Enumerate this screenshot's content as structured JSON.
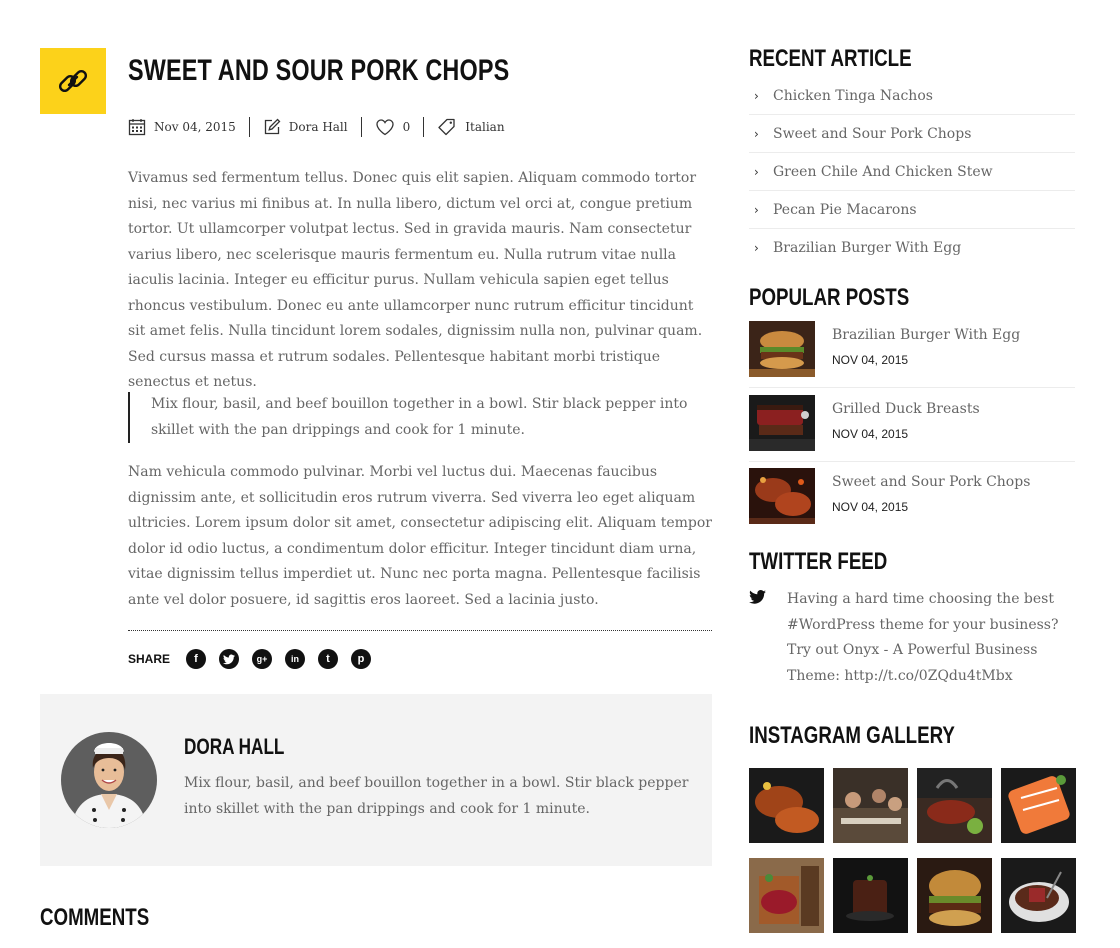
{
  "post": {
    "title": "SWEET AND SOUR PORK CHOPS",
    "icon": "link-icon",
    "accent": "#fcd21a",
    "date": "Nov 04, 2015",
    "author": "Dora Hall",
    "likes": "0",
    "category": "Italian",
    "paragraph1": "Vivamus sed fermentum tellus. Donec quis elit sapien. Aliquam commodo tortor nisi, nec varius mi finibus at. In nulla libero, dictum vel orci at, congue pretium tortor. Ut ullamcorper volutpat lectus. Sed in gravida mauris. Nam consectetur varius libero, nec scelerisque mauris fermentum eu. Nulla rutrum vitae nulla iaculis lacinia. Integer eu efficitur purus. Nullam vehicula sapien eget tellus rhoncus vestibulum. Donec eu ante ullamcorper nunc rutrum efficitur tincidunt sit amet felis. Nulla tincidunt lorem sodales, dignissim nulla non, pulvinar quam. Sed cursus massa et rutrum sodales. Pellentesque habitant morbi tristique senectus et netus.",
    "quote": "Mix flour, basil, and beef bouillon together in a bowl. Stir black pepper into skillet with the pan drippings and cook for 1 minute.",
    "paragraph2": "Nam vehicula commodo pulvinar. Morbi vel luctus dui. Maecenas faucibus dignissim ante, et sollicitudin eros rutrum viverra. Sed viverra leo eget aliquam ultricies. Lorem ipsum dolor sit amet, consectetur adipiscing elit. Aliquam tempor dolor id odio luctus, a condimentum dolor efficitur. Integer tincidunt diam urna, vitae dignissim tellus imperdiet ut. Nunc nec porta magna. Pellentesque facilisis ante vel dolor posuere, id sagittis eros laoreet. Sed a lacinia justo."
  },
  "share": {
    "label": "SHARE",
    "icons": [
      "facebook-icon",
      "twitter-icon",
      "google-plus-icon",
      "linkedin-icon",
      "tumblr-icon",
      "pinterest-icon"
    ]
  },
  "author_box": {
    "name": "DORA HALL",
    "bio": "Mix flour, basil, and beef bouillon together in a bowl. Stir black pepper into skillet with the pan drippings and cook for 1 minute."
  },
  "comments": {
    "title": "COMMENTS"
  },
  "sidebar": {
    "recent": {
      "title": "RECENT ARTICLE",
      "items": [
        "Chicken Tinga Nachos",
        "Sweet and Sour Pork Chops",
        "Green Chile And Chicken Stew",
        "Pecan Pie Macarons",
        "Brazilian Burger With Egg"
      ]
    },
    "popular": {
      "title": "POPULAR POSTS",
      "items": [
        {
          "title": "Brazilian Burger With Egg",
          "date": "NOV 04, 2015"
        },
        {
          "title": "Grilled Duck Breasts",
          "date": "NOV 04, 2015"
        },
        {
          "title": "Sweet and Sour Pork Chops",
          "date": "NOV 04, 2015"
        }
      ]
    },
    "twitter": {
      "title": "TWITTER FEED",
      "tweet": "Having a hard time choosing the best #WordPress theme for your business? Try out Onyx - A Powerful Business Theme: http://t.co/0ZQdu4tMbx"
    },
    "instagram": {
      "title": "INSTAGRAM GALLERY"
    }
  }
}
